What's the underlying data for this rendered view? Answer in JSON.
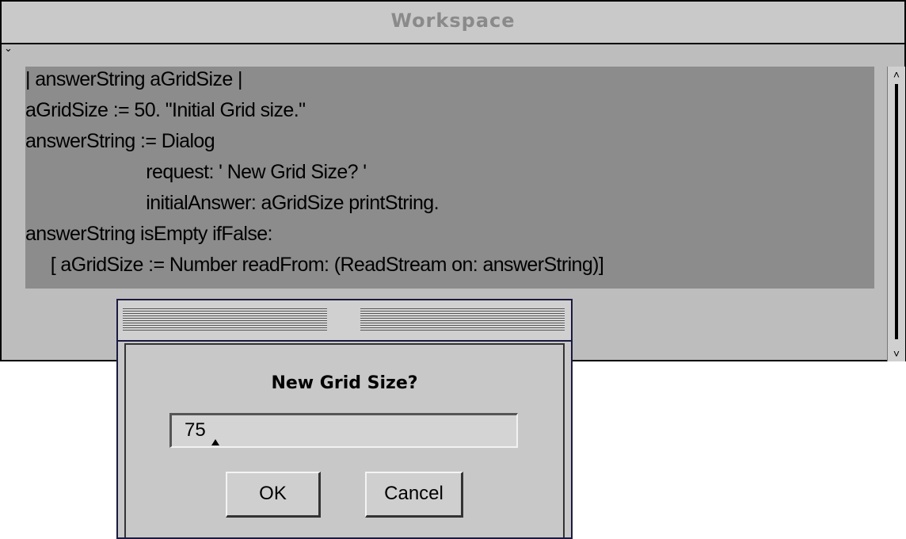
{
  "workspace": {
    "title": "Workspace",
    "menu_icon": "chevron-down-icon",
    "code_lines": [
      "| answerString aGridSize |",
      "aGridSize := 50. \"Initial Grid size.\"",
      "answerString := Dialog",
      "                        request: ' New Grid Size? '",
      "                        initialAnswer: aGridSize printString.",
      "answerString isEmpty ifFalse:",
      "     [ aGridSize := Number readFrom: (ReadStream on: answerString)]"
    ],
    "selection_color": "#8c8c8c",
    "scrollbar": {
      "up_icon": "scroll-up-arrow-icon",
      "down_icon": "scroll-down-arrow-icon"
    }
  },
  "dialog": {
    "prompt": "New Grid Size?",
    "input_value": "75",
    "ok_label": "OK",
    "cancel_label": "Cancel"
  }
}
